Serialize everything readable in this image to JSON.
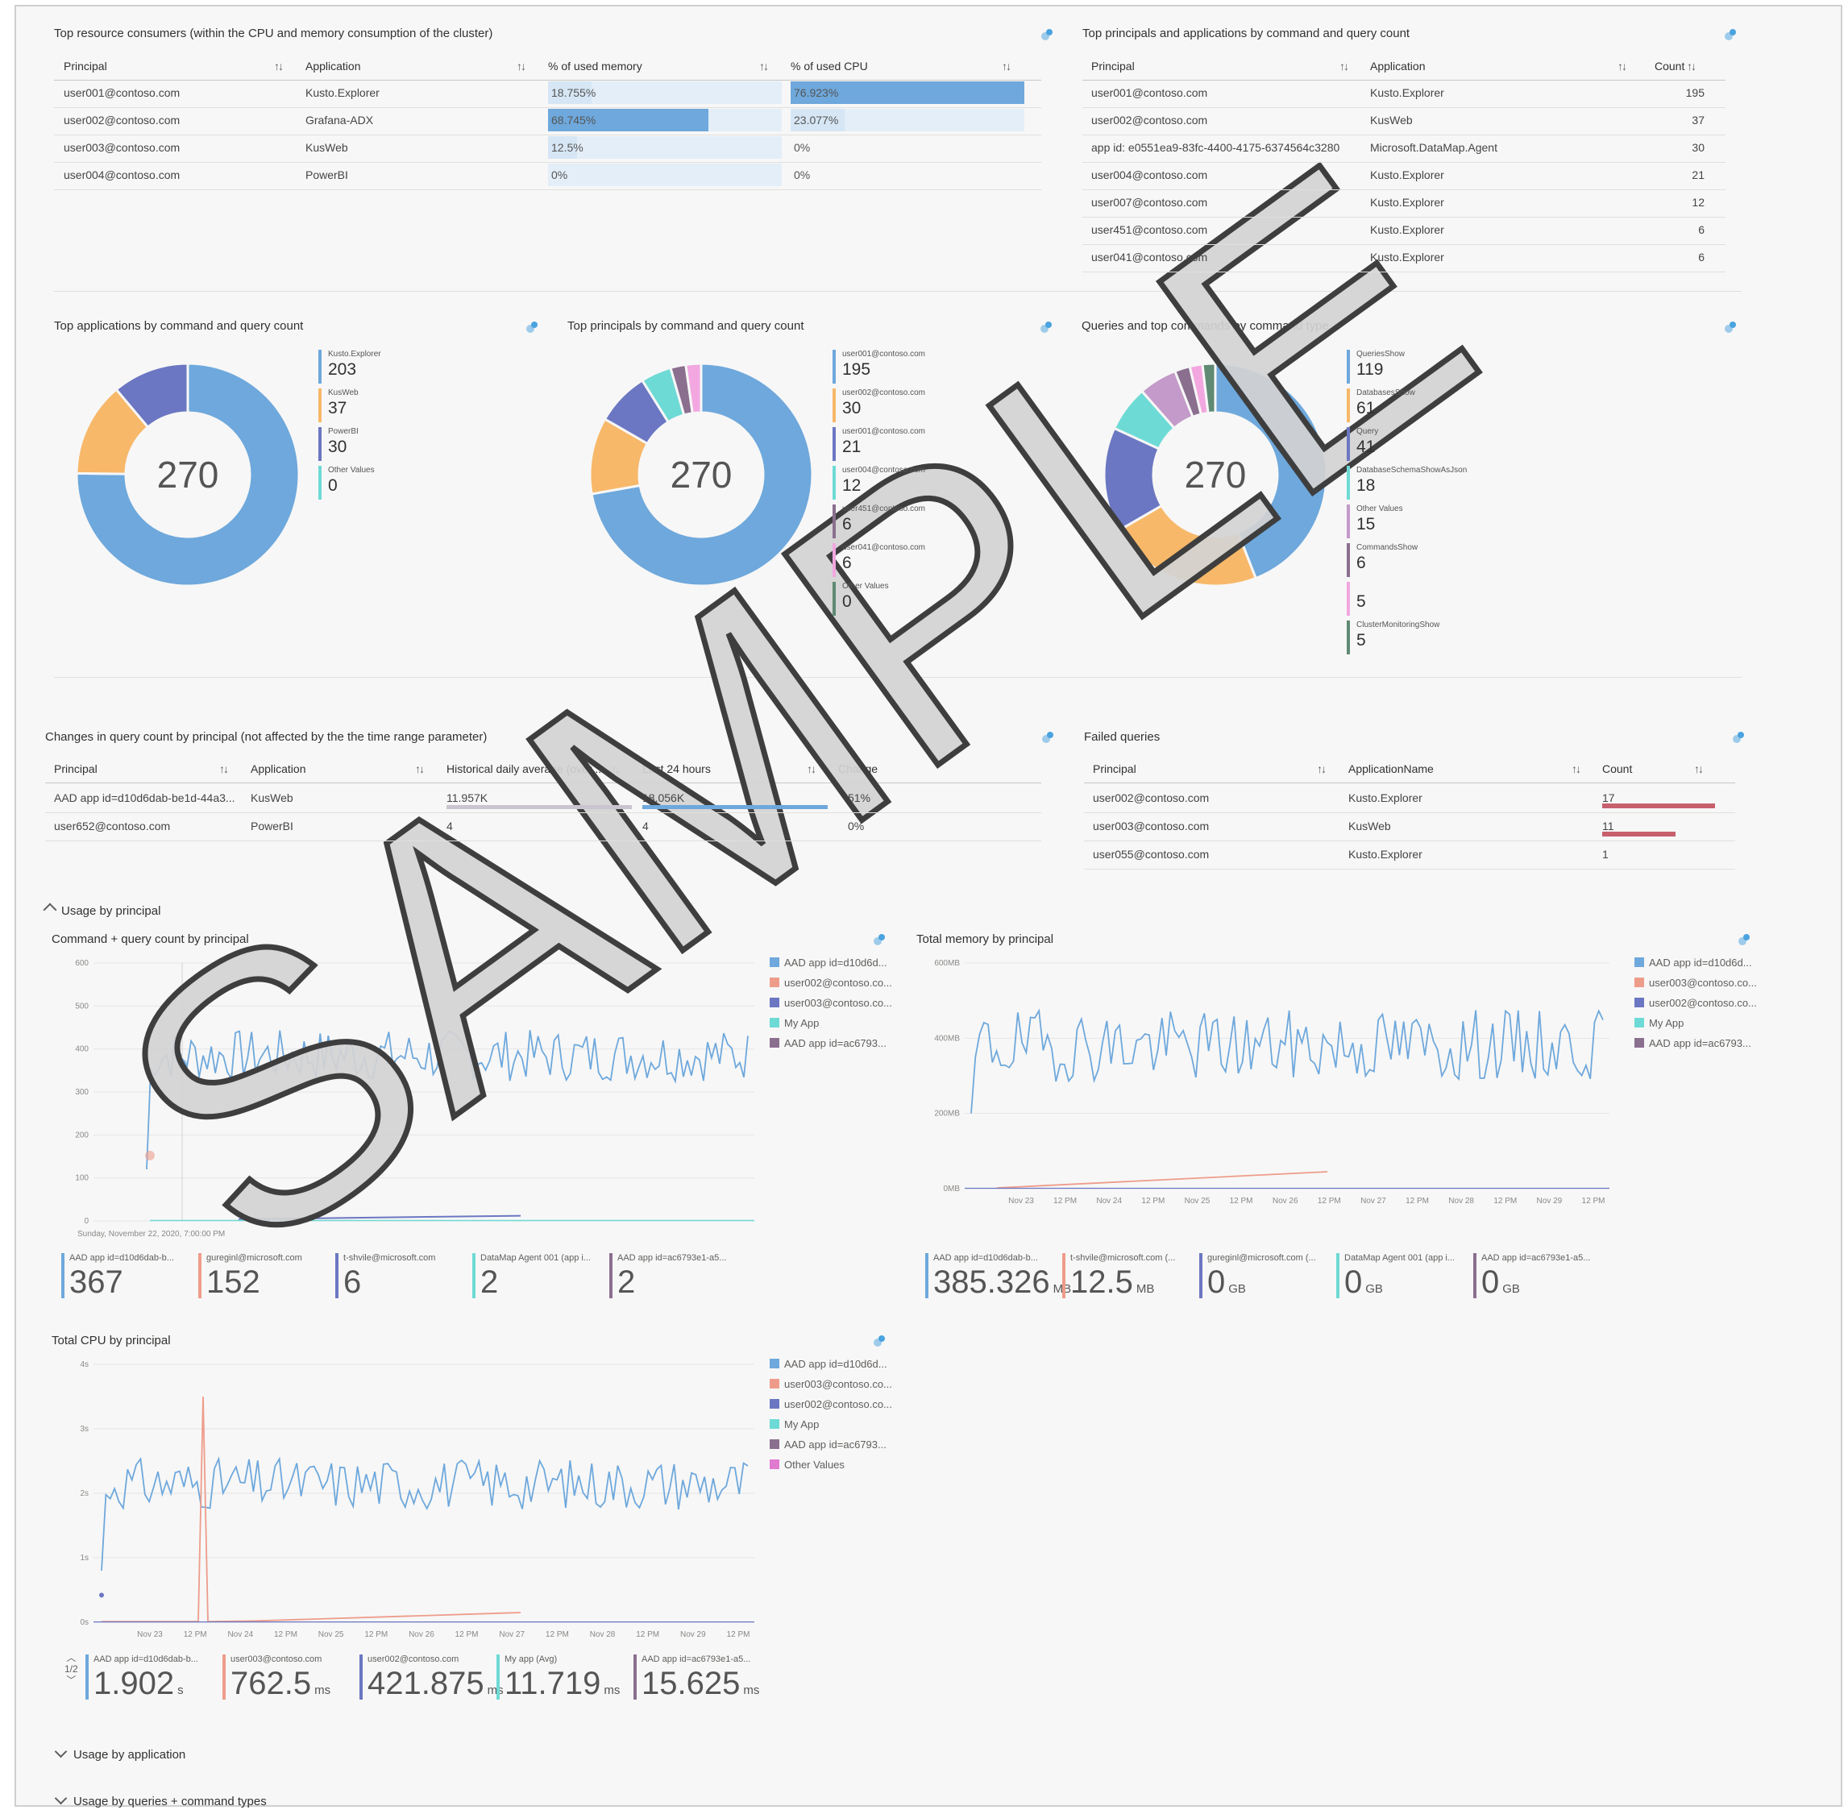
{
  "colors": {
    "blue": "#6ea8dc",
    "orange": "#f7b869",
    "purple": "#6b77c2",
    "teal": "#6edad5",
    "mauve": "#8b6f8f",
    "pink": "#f2a7e0",
    "green": "#5f8a73",
    "salmon": "#ee9c8a",
    "lilac": "#c39ac9",
    "red": "#c7606d",
    "gray": "#c9c4ce"
  },
  "resource": {
    "title": "Top resource consumers (within the CPU and memory consumption of the cluster)",
    "headers": [
      "Principal",
      "Application",
      "% of used memory",
      "% of used CPU"
    ],
    "rows": [
      {
        "principal": "user001@contoso.com",
        "app": "Kusto.Explorer",
        "mem": "18.755%",
        "mem_value": 18.755,
        "cpu": "76.923%",
        "cpu_value": 76.923
      },
      {
        "principal": "user002@contoso.com",
        "app": "Grafana-ADX",
        "mem": "68.745%",
        "mem_value": 68.745,
        "cpu": "23.077%",
        "cpu_value": 23.077
      },
      {
        "principal": "user003@contoso.com",
        "app": "KusWeb",
        "mem": "12.5%",
        "mem_value": 12.5,
        "cpu": "0%",
        "cpu_value": 0
      },
      {
        "principal": "user004@contoso.com",
        "app": "PowerBI",
        "mem": "0%",
        "mem_value": 0,
        "cpu": "0%",
        "cpu_value": 0
      }
    ]
  },
  "principals_apps": {
    "title": "Top principals and applications by command and query count",
    "headers": [
      "Principal",
      "Application",
      "Count"
    ],
    "rows": [
      {
        "principal": "user001@contoso.com",
        "app": "Kusto.Explorer",
        "count": "195"
      },
      {
        "principal": "user002@contoso.com",
        "app": "KusWeb",
        "count": "37"
      },
      {
        "principal": "app id: e0551ea9-83fc-4400-4175-6374564c3280",
        "app": "Microsoft.DataMap.Agent",
        "count": "30"
      },
      {
        "principal": "user004@contoso.com",
        "app": "Kusto.Explorer",
        "count": "21"
      },
      {
        "principal": "user007@contoso.com",
        "app": "Kusto.Explorer",
        "count": "12"
      },
      {
        "principal": "user451@contoso.com",
        "app": "Kusto.Explorer",
        "count": "6"
      },
      {
        "principal": "user041@contoso.com",
        "app": "Kusto.Explorer",
        "count": "6"
      }
    ]
  },
  "donut_apps": {
    "title": "Top applications by command and query count",
    "center": "270",
    "items": [
      {
        "label": "Kusto.Explorer",
        "value": "203",
        "n": 203,
        "color": "#6ea8dc"
      },
      {
        "label": "KusWeb",
        "value": "37",
        "n": 37,
        "color": "#f7b869"
      },
      {
        "label": "PowerBI",
        "value": "30",
        "n": 30,
        "color": "#6b77c2"
      },
      {
        "label": "Other Values",
        "value": "0",
        "n": 0,
        "color": "#6edad5"
      }
    ]
  },
  "donut_principals": {
    "title": "Top principals by command and query count",
    "center": "270",
    "items": [
      {
        "label": "user001@contoso.com",
        "value": "195",
        "n": 195,
        "color": "#6ea8dc"
      },
      {
        "label": "user002@contoso.com",
        "value": "30",
        "n": 30,
        "color": "#f7b869"
      },
      {
        "label": "user001@contoso.com",
        "value": "21",
        "n": 21,
        "color": "#6b77c2"
      },
      {
        "label": "user004@contoso.com",
        "value": "12",
        "n": 12,
        "color": "#6edad5"
      },
      {
        "label": "user451@contoso.com",
        "value": "6",
        "n": 6,
        "color": "#8b6f8f"
      },
      {
        "label": "user041@contoso.com",
        "value": "6",
        "n": 6,
        "color": "#f2a7e0"
      },
      {
        "label": "Other Values",
        "value": "0",
        "n": 0,
        "color": "#5f8a73"
      }
    ]
  },
  "donut_commands": {
    "title": "Queries and top commands by command type",
    "center": "270",
    "items": [
      {
        "label": "QueriesShow",
        "value": "119",
        "n": 119,
        "color": "#6ea8dc"
      },
      {
        "label": "DatabasesShow",
        "value": "61",
        "n": 61,
        "color": "#f7b869"
      },
      {
        "label": "Query",
        "value": "41",
        "n": 41,
        "color": "#6b77c2"
      },
      {
        "label": "DatabaseSchemaShowAsJson",
        "value": "18",
        "n": 18,
        "color": "#6edad5"
      },
      {
        "label": "Other Values",
        "value": "15",
        "n": 15,
        "color": "#c39ac9"
      },
      {
        "label": "CommandsShow",
        "value": "6",
        "n": 6,
        "color": "#8b6f8f"
      },
      {
        "label": "",
        "value": "5",
        "n": 5,
        "color": "#f2a7e0"
      },
      {
        "label": "ClusterMonitoringShow",
        "value": "5",
        "n": 5,
        "color": "#5f8a73"
      }
    ]
  },
  "changes": {
    "title": "Changes in query count by principal (not affected by the the time range parameter)",
    "headers": [
      "Principal",
      "Application",
      "Historical daily average (over ...",
      "Last 24 hours",
      "Change"
    ],
    "rows": [
      {
        "principal": "AAD app id=d10d6dab-be1d-44a3...",
        "app": "KusWeb",
        "hist": "11.957K",
        "last": "18.056K",
        "change": "51%"
      },
      {
        "principal": "user652@contoso.com",
        "app": "PowerBI",
        "hist": "4",
        "last": "4",
        "change": "0%"
      }
    ]
  },
  "failed": {
    "title": "Failed queries",
    "headers": [
      "Principal",
      "ApplicationName",
      "Count"
    ],
    "rows": [
      {
        "principal": "user002@contoso.com",
        "app": "Kusto.Explorer",
        "count": "17",
        "n": 17
      },
      {
        "principal": "user003@contoso.com",
        "app": "KusWeb",
        "count": "11",
        "n": 11
      },
      {
        "principal": "user055@contoso.com",
        "app": "Kusto.Explorer",
        "count": "1",
        "n": 1
      }
    ]
  },
  "sections": {
    "usage_principal": "Usage by principal",
    "usage_application": "Usage by application",
    "usage_queries": "Usage by queries + command types"
  },
  "chart_data": [
    {
      "type": "line",
      "title": "Command + query count by principal",
      "y_ticks": [
        "600",
        "500",
        "400",
        "300",
        "200",
        "100",
        "0"
      ],
      "ylim": [
        0,
        600
      ],
      "x_start_label": "Sunday, November 22, 2020, 7:00:00 PM",
      "legend": [
        "AAD app id=d10d6d...",
        "user002@contoso.co...",
        "user003@contoso.co...",
        "My App",
        "AAD app id=ac6793..."
      ],
      "legend_colors": [
        "#6ea8dc",
        "#ee9c8a",
        "#6b77c2",
        "#6edad5",
        "#8b6f8f"
      ],
      "series_main_typical": 390,
      "tiles": [
        {
          "label": "AAD app id=d10d6dab-b...",
          "value": "367",
          "unit": "",
          "color": "#6ea8dc"
        },
        {
          "label": "gureginl@microsoft.com",
          "value": "152",
          "unit": "",
          "color": "#ee9c8a"
        },
        {
          "label": "t-shvile@microsoft.com",
          "value": "6",
          "unit": "",
          "color": "#6b77c2"
        },
        {
          "label": "DataMap Agent 001 (app i...",
          "value": "2",
          "unit": "",
          "color": "#6edad5"
        },
        {
          "label": "AAD app id=ac6793e1-a5...",
          "value": "2",
          "unit": "",
          "color": "#8b6f8f"
        }
      ]
    },
    {
      "type": "line",
      "title": "Total memory by principal",
      "y_ticks": [
        "600MB",
        "400MB",
        "200MB",
        "0MB"
      ],
      "ylim": [
        0,
        600
      ],
      "x_ticks": [
        "Nov 23",
        "12 PM",
        "Nov 24",
        "12 PM",
        "Nov 25",
        "12 PM",
        "Nov 26",
        "12 PM",
        "Nov 27",
        "12 PM",
        "Nov 28",
        "12 PM",
        "Nov 29",
        "12 PM"
      ],
      "legend": [
        "AAD app id=d10d6d...",
        "user003@contoso.co...",
        "user002@contoso.co...",
        "My App",
        "AAD app id=ac6793..."
      ],
      "legend_colors": [
        "#6ea8dc",
        "#ee9c8a",
        "#6b77c2",
        "#6edad5",
        "#8b6f8f"
      ],
      "tiles": [
        {
          "label": "AAD app id=d10d6dab-b...",
          "value": "385.326",
          "unit": "MB",
          "color": "#6ea8dc"
        },
        {
          "label": "t-shvile@microsoft.com (...",
          "value": "12.5",
          "unit": "MB",
          "color": "#ee9c8a"
        },
        {
          "label": "gureginl@microsoft.com (...",
          "value": "0",
          "unit": "GB",
          "color": "#6b77c2"
        },
        {
          "label": "DataMap Agent 001 (app i...",
          "value": "0",
          "unit": "GB",
          "color": "#6edad5"
        },
        {
          "label": "AAD app id=ac6793e1-a5...",
          "value": "0",
          "unit": "GB",
          "color": "#8b6f8f"
        }
      ]
    },
    {
      "type": "line",
      "title": "Total CPU by principal",
      "y_ticks": [
        "4s",
        "3s",
        "2s",
        "1s",
        "0s"
      ],
      "ylim": [
        0,
        4
      ],
      "x_ticks": [
        "Nov 23",
        "12 PM",
        "Nov 24",
        "12 PM",
        "Nov 25",
        "12 PM",
        "Nov 26",
        "12 PM",
        "Nov 27",
        "12 PM",
        "Nov 28",
        "12 PM",
        "Nov 29",
        "12 PM"
      ],
      "legend": [
        "AAD app id=d10d6d...",
        "user003@contoso.co...",
        "user002@contoso.co...",
        "My App",
        "AAD app id=ac6793...",
        "Other Values"
      ],
      "legend_colors": [
        "#6ea8dc",
        "#ee9c8a",
        "#6b77c2",
        "#6edad5",
        "#8b6f8f",
        "#e07bd0"
      ],
      "pager": "1/2",
      "tiles": [
        {
          "label": "AAD app id=d10d6dab-b...",
          "value": "1.902",
          "unit": "s",
          "color": "#6ea8dc"
        },
        {
          "label": "user003@contoso.com",
          "value": "762.5",
          "unit": "ms",
          "color": "#ee9c8a"
        },
        {
          "label": "user002@contoso.com",
          "value": "421.875",
          "unit": "ms",
          "color": "#6b77c2"
        },
        {
          "label": "My app (Avg)",
          "value": "11.719",
          "unit": "ms",
          "color": "#6edad5"
        },
        {
          "label": "AAD app id=ac6793e1-a5...",
          "value": "15.625",
          "unit": "ms",
          "color": "#8b6f8f"
        }
      ]
    }
  ],
  "watermark": "SAMPLE"
}
